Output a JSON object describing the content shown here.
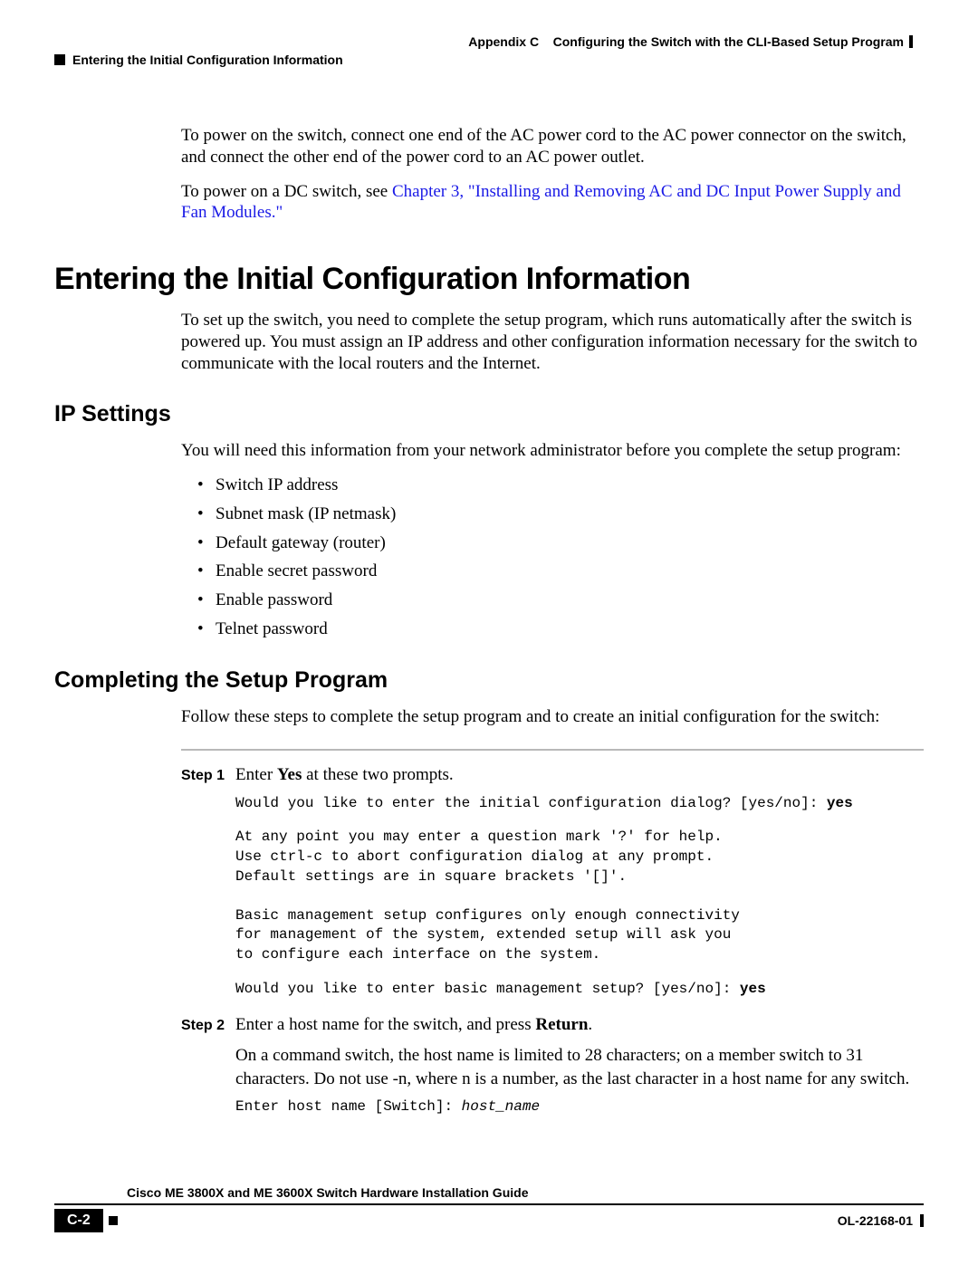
{
  "header": {
    "appendix": "Appendix C",
    "appendix_title": "Configuring the Switch with the CLI-Based Setup Program",
    "section_running": "Entering the Initial Configuration Information"
  },
  "intro": {
    "p1": "To power on the switch, connect one end of the AC power cord to the AC power connector on the switch, and connect the other end of the power cord to an AC power outlet.",
    "p2a": "To power on a DC switch, see ",
    "p2_link": "Chapter 3, \"Installing and Removing AC and DC Input Power Supply and Fan Modules.\""
  },
  "h1": "Entering the Initial Configuration Information",
  "h1_para": "To set up the switch, you need to complete the setup program, which runs automatically after the switch is powered up. You must assign an IP address and other configuration information necessary for the switch to communicate with the local routers and the Internet.",
  "h2_ip": "IP Settings",
  "ip_para": "You will need this information from your network administrator before you complete the setup program:",
  "ip_list": [
    "Switch IP address",
    "Subnet mask (IP netmask)",
    "Default gateway (router)",
    "Enable secret password",
    "Enable password",
    "Telnet password"
  ],
  "h2_setup": "Completing the Setup Program",
  "setup_para": "Follow these steps to complete the setup program and to create an initial configuration for the switch:",
  "steps": {
    "s1_label": "Step 1",
    "s1_text_a": "Enter ",
    "s1_text_bold": "Yes",
    "s1_text_b": " at these two prompts.",
    "s1_code_l1a": "Would you like to enter the initial configuration dialog? [yes/no]: ",
    "s1_code_l1b": "yes",
    "s1_code_block": "At any point you may enter a question mark '?' for help.\nUse ctrl-c to abort configuration dialog at any prompt.\nDefault settings are in square brackets '[]'.\n\nBasic management setup configures only enough connectivity\nfor management of the system, extended setup will ask you\nto configure each interface on the system.",
    "s1_code_l2a": "Would you like to enter basic management setup? [yes/no]: ",
    "s1_code_l2b": "yes",
    "s2_label": "Step 2",
    "s2_text_a": "Enter a host name for the switch, and press ",
    "s2_text_bold": "Return",
    "s2_text_b": ".",
    "s2_note_a": "On a command switch, the host name is limited to 28 characters; on a member switch to 31 characters. Do not use ",
    "s2_note_ital": "-n",
    "s2_note_b": ", where n is a number, as the last character in a host name for any switch.",
    "s2_code_a": "Enter host name [Switch]: ",
    "s2_code_ital": "host_name"
  },
  "footer": {
    "guide": "Cisco ME 3800X and ME 3600X Switch Hardware Installation Guide",
    "page": "C-2",
    "docid": "OL-22168-01"
  }
}
